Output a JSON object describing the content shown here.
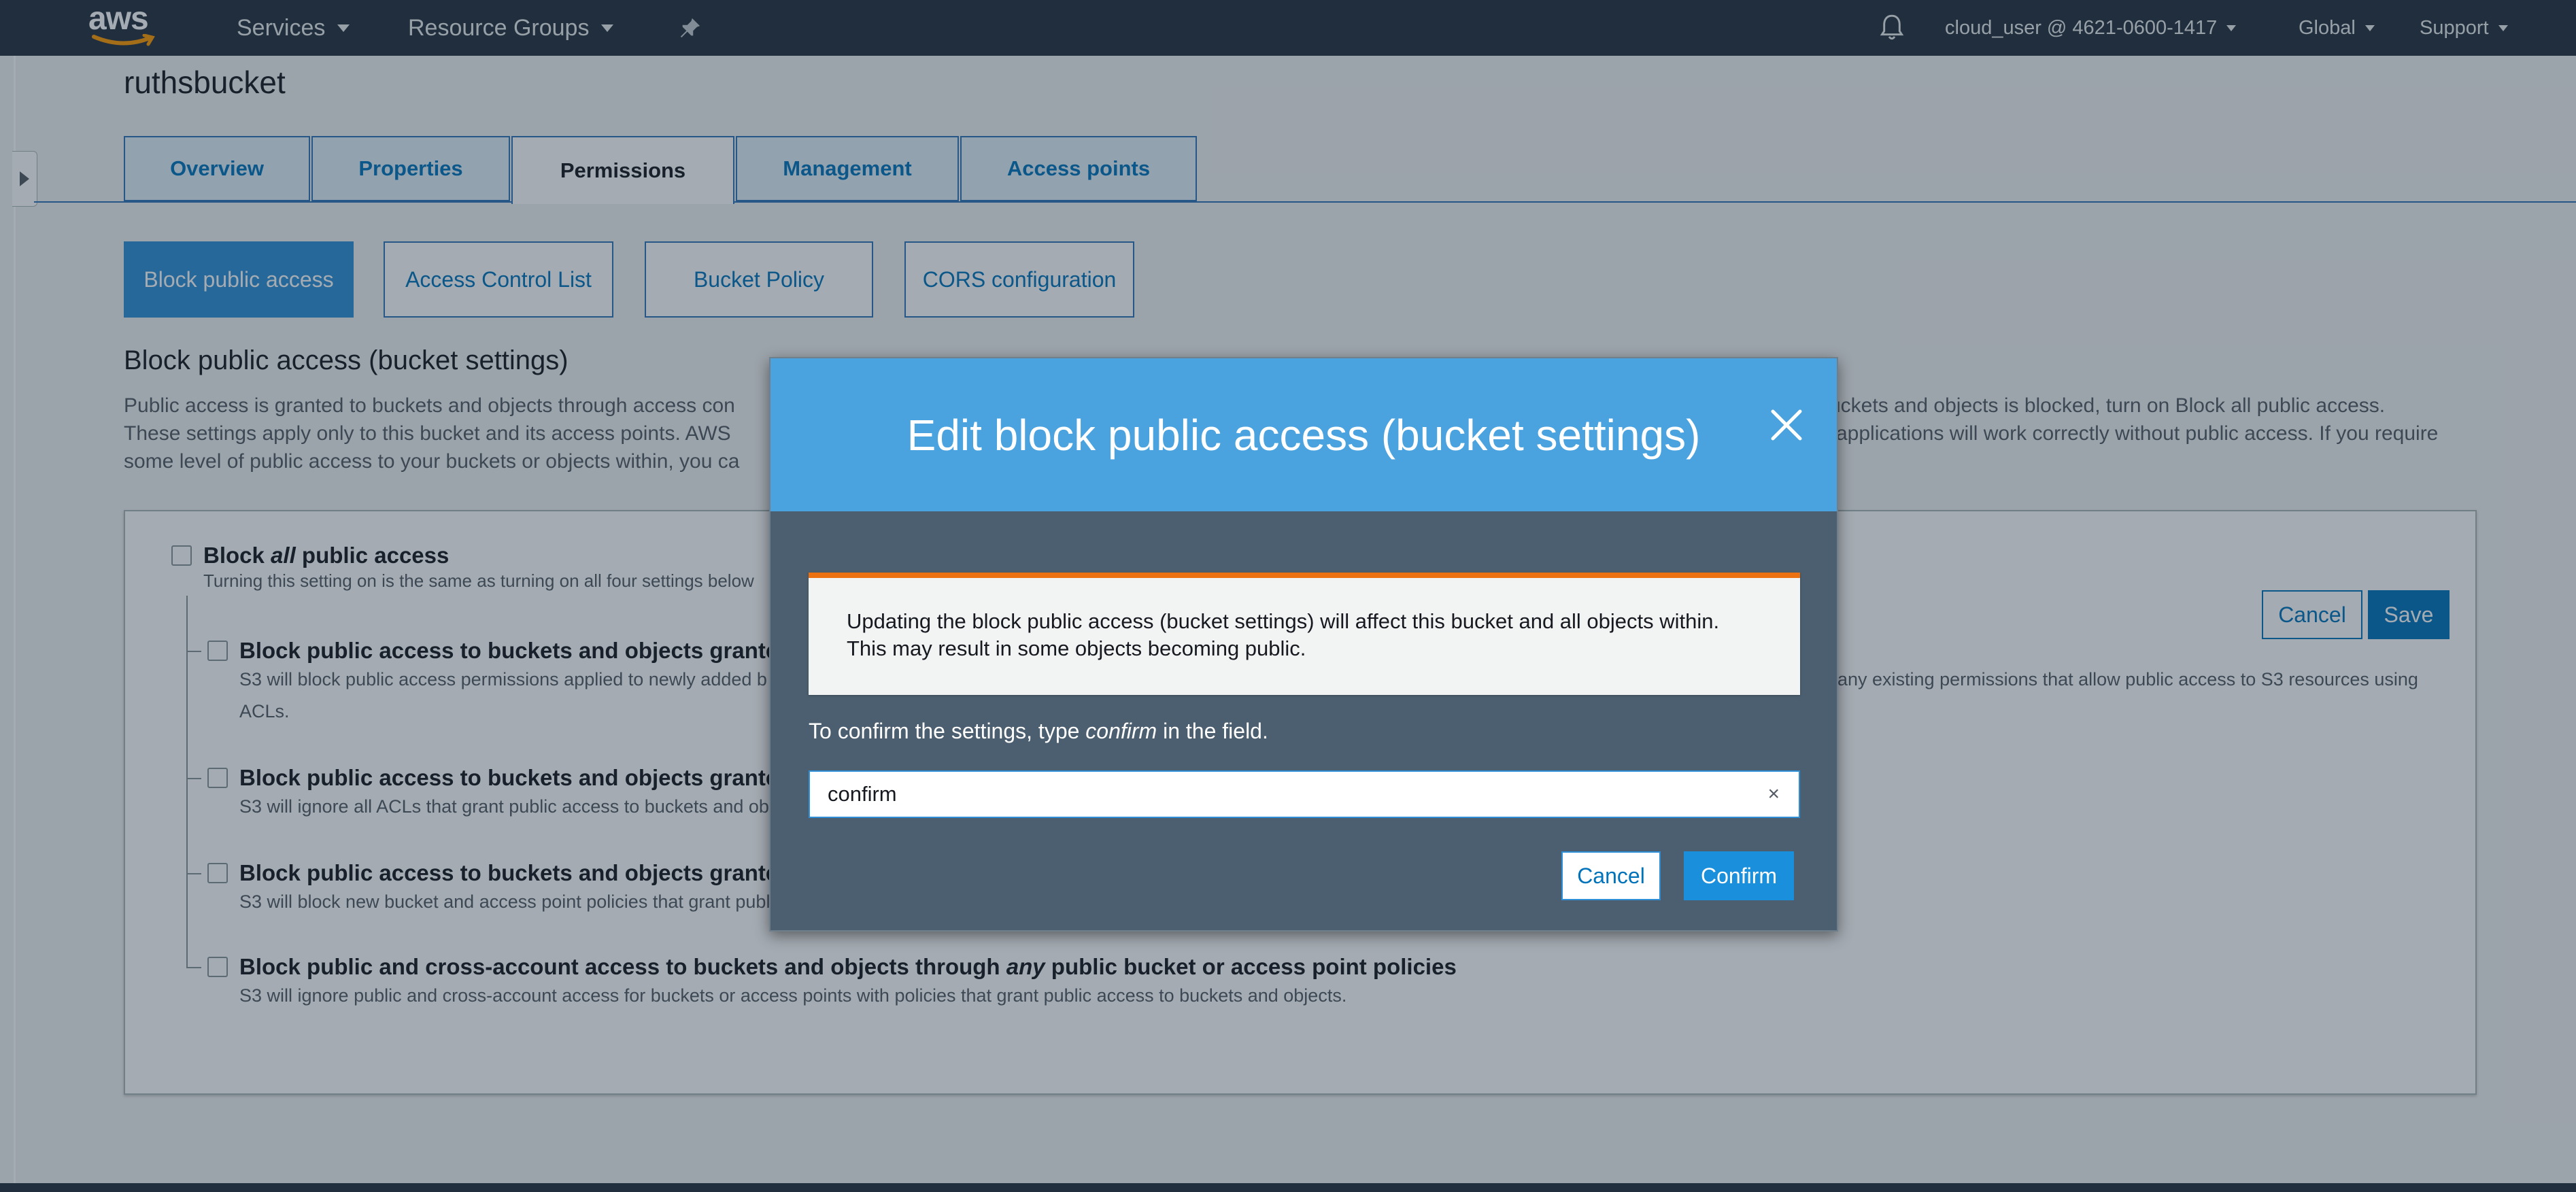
{
  "topnav": {
    "logo": "aws",
    "services": "Services",
    "resource_groups": "Resource Groups",
    "pin_icon": "pin-icon",
    "bell_icon": "bell-icon",
    "account": "cloud_user @ 4621-0600-1417",
    "region": "Global",
    "support": "Support"
  },
  "bucket": {
    "name": "ruthsbucket"
  },
  "tabs": [
    "Overview",
    "Properties",
    "Permissions",
    "Management",
    "Access points"
  ],
  "active_tab": "Permissions",
  "subtabs": [
    "Block public access",
    "Access Control List",
    "Bucket Policy",
    "CORS configuration"
  ],
  "active_subtab": "Block public access",
  "section": {
    "title": "Block public access (bucket settings)",
    "desc_line1_left": "Public access is granted to buckets and objects through access con",
    "desc_line1_right": "uckets and objects is blocked, turn on Block all public access.",
    "desc_line2_left": "These settings apply only to this bucket and its access points. AWS",
    "desc_line2_right": "applications will work correctly without public access. If you require",
    "desc_line3_left": "some level of public access to your buckets or objects within, you ca"
  },
  "settings": {
    "cancel": "Cancel",
    "save": "Save",
    "block_all_prefix": "Block ",
    "block_all_em": "all",
    "block_all_suffix": " public access",
    "block_all_desc": "Turning this setting on is the same as turning on all four settings below",
    "opt1_label": "Block public access to buckets and objects granted",
    "opt1_desc_left": "S3 will block public access permissions applied to newly added b",
    "opt1_desc_right": "any existing permissions that allow public access to S3 resources using",
    "opt1_desc_line2": "ACLs.",
    "opt2_label": "Block public access to buckets and objects granted",
    "opt2_desc": "S3 will ignore all ACLs that grant public access to buckets and ob",
    "opt3_label": "Block public access to buckets and objects granted",
    "opt3_desc": "S3 will block new bucket and access point policies that grant publ",
    "opt4_label_a": "Block public and cross-account access to buckets and objects through ",
    "opt4_label_em": "any",
    "opt4_label_b": " public bucket or access point policies",
    "opt4_desc": "S3 will ignore public and cross-account access for buckets or access points with policies that grant public access to buckets and objects."
  },
  "modal": {
    "title": "Edit block public access (bucket settings)",
    "close_icon": "close-icon",
    "notice_line1": "Updating the block public access (bucket settings) will affect this bucket and all objects within.",
    "notice_line2": "This may result in some objects becoming public.",
    "hint_prefix": "To confirm the settings, type ",
    "hint_em": "confirm",
    "hint_suffix": " in the field.",
    "input_value": "confirm",
    "clear": "×",
    "cancel": "Cancel",
    "confirm": "Confirm"
  },
  "colors": {
    "nav": "#232f3e",
    "modal_header": "#4aa3df",
    "modal_body": "#4b5f70",
    "primary": "#0073bb",
    "warning": "#ec7211"
  }
}
